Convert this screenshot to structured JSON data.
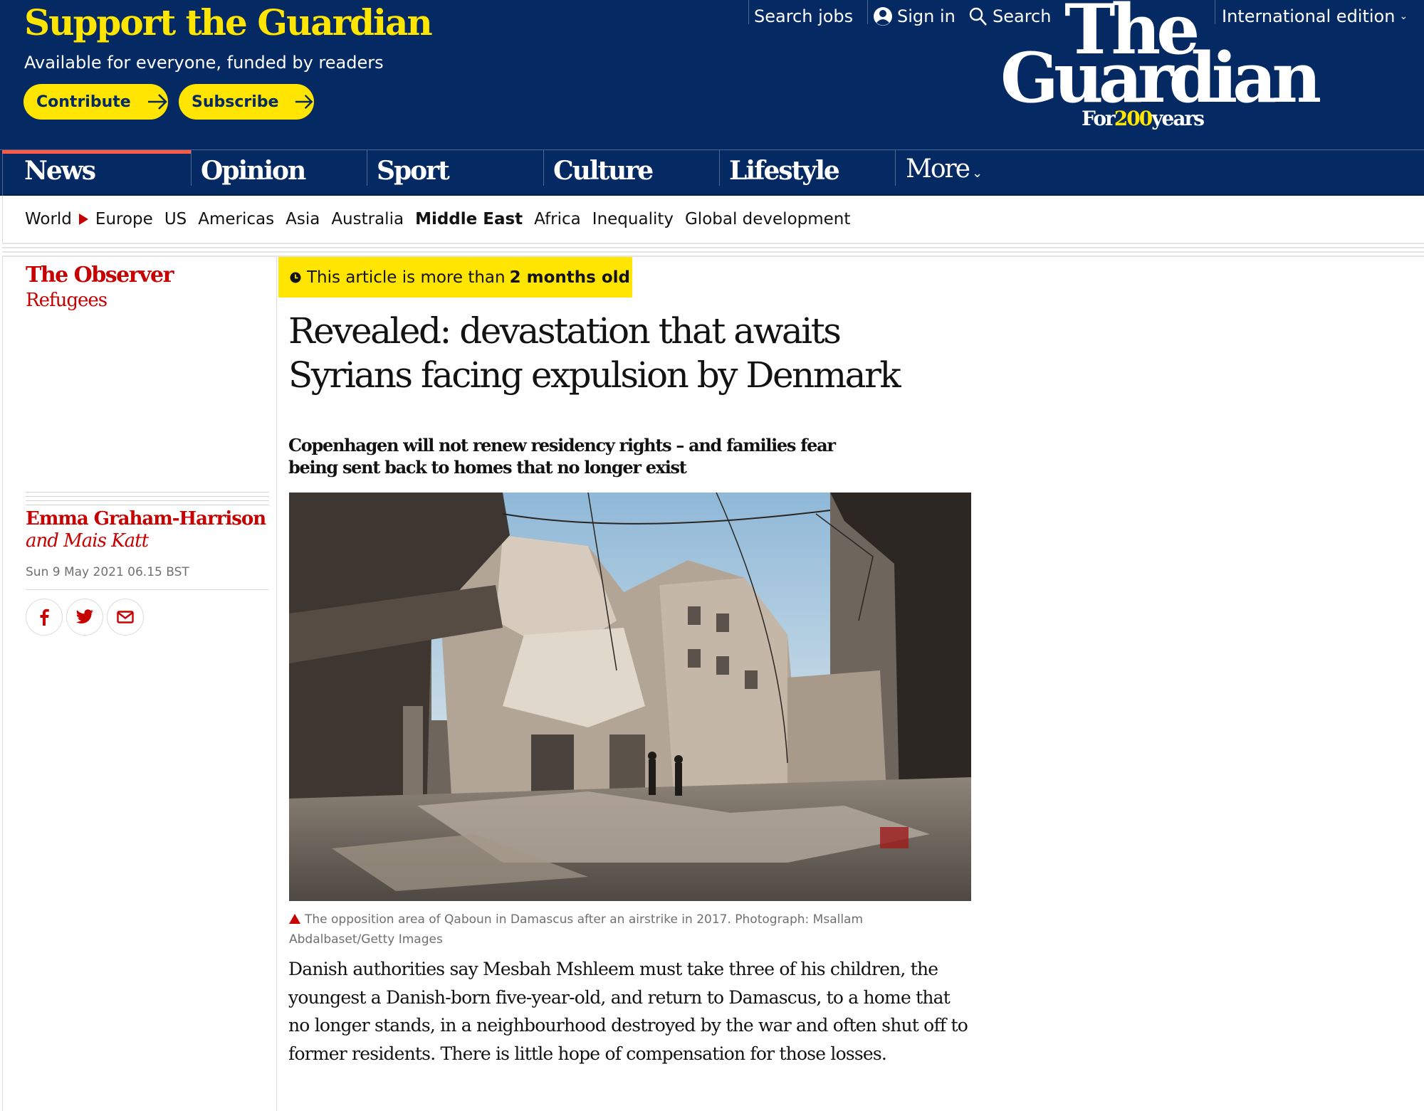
{
  "support": {
    "title": "Support the Guardian",
    "subtitle": "Available for everyone, funded by readers",
    "contribute_label": "Contribute",
    "subscribe_label": "Subscribe"
  },
  "toplinks": {
    "search_jobs": "Search jobs",
    "sign_in": "Sign in",
    "search": "Search",
    "edition": "International edition"
  },
  "logo": {
    "line1": "The",
    "line2": "Guardian",
    "tag_prefix": "For",
    "tag_years": "200",
    "tag_suffix": "years"
  },
  "nav": {
    "items": [
      {
        "label": "News",
        "active": true
      },
      {
        "label": "Opinion"
      },
      {
        "label": "Sport"
      },
      {
        "label": "Culture"
      },
      {
        "label": "Lifestyle"
      }
    ],
    "more_label": "More"
  },
  "subnav": {
    "parent": "World",
    "items": [
      "Europe",
      "US",
      "Americas",
      "Asia",
      "Australia",
      "Middle East",
      "Africa",
      "Inequality",
      "Global development"
    ],
    "current": "Middle East"
  },
  "sidebar": {
    "series": "The Observer",
    "section": "Refugees",
    "author": "Emma Graham-Harrison",
    "co_author": "and Mais Katt",
    "date": "Sun 9 May 2021 06.15 BST",
    "share": [
      "facebook-icon",
      "twitter-icon",
      "email-icon"
    ]
  },
  "article": {
    "age_prefix": "This article is more than",
    "age_value": "2 months old",
    "headline": "Revealed: devastation that awaits Syrians facing expulsion by Denmark",
    "standfirst": "Copenhagen will not renew residency rights – and families fear being sent back to homes that no longer exist",
    "image_alt": "Bombed-out buildings and rubble in a street in Qaboun, Damascus",
    "caption": "The opposition area of Qaboun in Damascus after an airstrike in 2017. Photograph: Msallam Abdalbaset/Getty Images",
    "body": "Danish authorities say Mesbah Mshleem must take three of his children, the youngest a Danish-born five-year-old, and return to Damascus, to a home that no longer stands, in a neighbourhood destroyed by the war and often shut off to former residents. There is little hope of compensation for those losses."
  },
  "colors": {
    "brand_blue": "#052962",
    "brand_yellow": "#ffe500",
    "news_red": "#c70000",
    "nav_active": "#ff5943"
  }
}
